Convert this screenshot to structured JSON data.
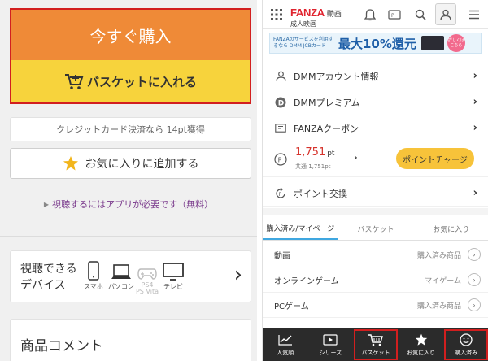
{
  "left": {
    "buy_label": "今すぐ購入",
    "basket_label": "バスケットに入れる",
    "points_note": "クレジットカード決済なら 14pt獲得",
    "favorite_label": "お気に入りに追加する",
    "app_link": "視聴するにはアプリが必要です（無料）",
    "devices": {
      "label_line1": "視聴できる",
      "label_line2": "デバイス",
      "items": [
        {
          "icon": "smartphone-icon",
          "caption": "スマホ",
          "enabled": true
        },
        {
          "icon": "pc-icon",
          "caption": "パソコン",
          "enabled": true
        },
        {
          "icon": "ps-vita-icon",
          "caption": "PS4\nPS Vita",
          "enabled": false
        },
        {
          "icon": "tv-icon",
          "caption": "テレビ",
          "enabled": true
        }
      ]
    },
    "comment_title": "商品コメント"
  },
  "header": {
    "brand": "FANZA",
    "section": "動画",
    "subsection": "成人映画",
    "icons": [
      "grid-menu-icon",
      "bell-icon",
      "points-card-icon",
      "search-icon",
      "user-icon",
      "hamburger-icon"
    ]
  },
  "banner": {
    "small_text": "FANZAのサービスを利用するなら DMM JCBカード",
    "big_text": "最大10%還元",
    "badge_text": "詳しくはこちら"
  },
  "account_menu": [
    {
      "icon": "person-icon",
      "label": "DMMアカウント情報"
    },
    {
      "icon": "dmm-premium-icon",
      "label": "DMMプレミアム"
    },
    {
      "icon": "coupon-icon",
      "label": "FANZAクーポン"
    }
  ],
  "points": {
    "value": "1,751",
    "unit": "pt",
    "total": "共通 1,751pt",
    "charge_label": "ポイントチャージ"
  },
  "exchange_label": "ポイント交換",
  "tabs": [
    {
      "label": "購入済み/マイページ",
      "active": true
    },
    {
      "label": "バスケット",
      "active": false
    },
    {
      "label": "お気に入り",
      "active": false
    }
  ],
  "mypage_list": [
    {
      "label": "動画",
      "right": "購入済み商品"
    },
    {
      "label": "オンラインゲーム",
      "right": "マイゲーム"
    },
    {
      "label": "PCゲーム",
      "right": "購入済み商品"
    }
  ],
  "bottom_nav": [
    {
      "icon": "ranking-icon",
      "label": "人気順",
      "highlighted": false
    },
    {
      "icon": "series-icon",
      "label": "シリーズ",
      "highlighted": false
    },
    {
      "icon": "basket-icon",
      "label": "バスケット",
      "highlighted": true
    },
    {
      "icon": "star-icon",
      "label": "お気に入り",
      "highlighted": false
    },
    {
      "icon": "purchased-icon",
      "label": "購入済み",
      "highlighted": true
    }
  ],
  "colors": {
    "buy": "#ef8a37",
    "basket": "#f7d33c",
    "highlight_border": "#d21f1f",
    "brand_red": "#e0242f",
    "points_red": "#d6332c",
    "charge_yellow": "#f7c33a",
    "tab_accent": "#3fa7e0",
    "bottom_bar": "#2b2b2b"
  }
}
